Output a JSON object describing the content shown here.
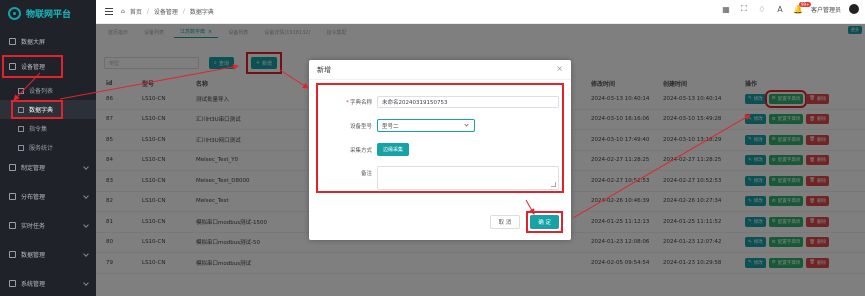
{
  "app": {
    "logo_text": "物联网平台"
  },
  "sidebar": {
    "items": [
      {
        "label": "数据大屏"
      },
      {
        "label": "设备管理"
      },
      {
        "label": "设备列表"
      },
      {
        "label": "数据字典"
      },
      {
        "label": "指令集"
      },
      {
        "label": "服务统计"
      },
      {
        "label": "制定管理"
      },
      {
        "label": "分布管理"
      },
      {
        "label": "实时任务"
      },
      {
        "label": "数据管理"
      },
      {
        "label": "系统管理"
      }
    ]
  },
  "header": {
    "breadcrumb": [
      "首页",
      "设备管理",
      "数据字典"
    ],
    "badge": "99+",
    "user": "客户管理员"
  },
  "tabs": [
    {
      "label": "首页指示"
    },
    {
      "label": "设备列表"
    },
    {
      "label": "江苏数字典"
    },
    {
      "label": "设备列表"
    },
    {
      "label": "设备详情(1918132)"
    },
    {
      "label": "指令集配"
    }
  ],
  "tabs_more": "更多",
  "toolbar": {
    "search_placeholder": "类型",
    "search_button": "查询",
    "add_button": "新增"
  },
  "table": {
    "headers": {
      "id": "id",
      "model": "型号",
      "name": "名称",
      "modified": "修改时间",
      "created": "创建时间",
      "ops": "操作"
    },
    "rows": [
      {
        "id": "86",
        "model": "LS10-CN",
        "name": "测试批量导入",
        "modified": "2024-03-13 10:40:14",
        "created": "2024-03-13 10:40:14"
      },
      {
        "id": "87",
        "model": "LS10-CN",
        "name": "汇川H3U串口测试",
        "modified": "2024-03-10 16:16:06",
        "created": "2024-03-10 15:49:28"
      },
      {
        "id": "85",
        "model": "LS10-CN",
        "name": "汇川H3U网口测试",
        "modified": "2024-03-10 17:49:40",
        "created": "2024-03-10 13:18:29"
      },
      {
        "id": "84",
        "model": "LS10-CN",
        "name": "Melsec_Test_Y0",
        "modified": "2024-02-27 11:28:25",
        "created": "2024-02-27 11:28:25"
      },
      {
        "id": "83",
        "model": "LS10-CN",
        "name": "Melsec_Test_D8000",
        "modified": "2024-02-27 10:52:53",
        "created": "2024-02-27 10:52:53"
      },
      {
        "id": "82",
        "model": "LS10-CN",
        "name": "Melsec_Test",
        "modified": "2024-02-26 10:46:39",
        "created": "2024-02-26 10:27:34"
      },
      {
        "id": "81",
        "model": "LS10-CN",
        "name": "模拟串口modbus测试-1500",
        "modified": "2024-01-25 11:12:13",
        "created": "2024-01-25 11:11:52"
      },
      {
        "id": "80",
        "model": "LS10-CN",
        "name": "模拟串口modbus测试-50",
        "modified": "2024-01-23 12:08:06",
        "created": "2024-01-23 12:07:42"
      },
      {
        "id": "79",
        "model": "LS10-CN",
        "name": "模拟串口modbus测试",
        "modified": "2024-02-05 09:54:54",
        "created": "2024-01-23 10:29:58"
      }
    ],
    "op_edit": "修改",
    "op_config": "配置字典项",
    "op_delete": "删除"
  },
  "modal": {
    "title": "新增",
    "close": "×",
    "fields": {
      "name_label": "字典名称",
      "name_value": "未命名20240319150753",
      "model_label": "设备型号",
      "model_value": "型号二",
      "mode_label": "采集方式",
      "mode_value": "边缘采集",
      "remark_label": "备注"
    },
    "cancel": "取 消",
    "ok": "确 定"
  },
  "colors": {
    "accent": "#16a2a7",
    "highlight": "#e3232c"
  }
}
